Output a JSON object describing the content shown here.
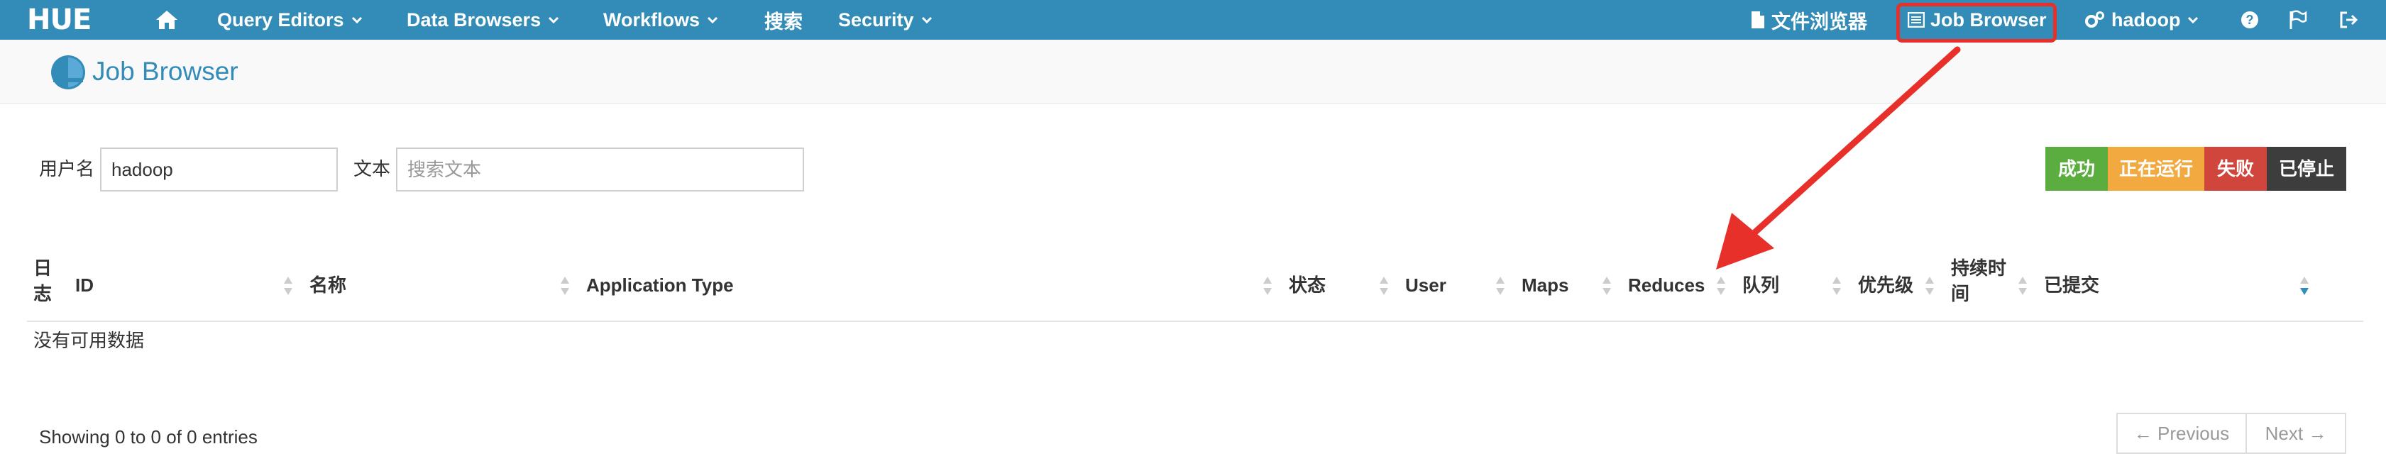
{
  "app": {
    "logo": "HUE"
  },
  "nav": {
    "query_editors": "Query Editors",
    "data_browsers": "Data Browsers",
    "workflows": "Workflows",
    "search": "搜索",
    "security": "Security",
    "file_browser": "文件浏览器",
    "job_browser": "Job Browser",
    "user": "hadoop"
  },
  "page": {
    "title": "Job Browser"
  },
  "filters": {
    "username_label": "用户名",
    "username_value": "hadoop",
    "text_label": "文本",
    "text_placeholder": "搜索文本"
  },
  "status_buttons": [
    {
      "label": "成功",
      "color": "#5cad3f"
    },
    {
      "label": "正在运行",
      "color": "#f1a940"
    },
    {
      "label": "失败",
      "color": "#d0453c"
    },
    {
      "label": "已停止",
      "color": "#3d3d3d"
    }
  ],
  "table": {
    "headers": {
      "log_line1": "日",
      "log_line2": "志",
      "id": "ID",
      "name": "名称",
      "application_type": "Application Type",
      "status": "状态",
      "user": "User",
      "maps": "Maps",
      "reduces": "Reduces",
      "queue": "队列",
      "priority": "优先级",
      "duration_line1": "持续时",
      "duration_line2": "间",
      "submitted": "已提交"
    },
    "empty_message": "没有可用数据"
  },
  "footer": {
    "showing": "Showing 0 to 0 of 0 entries",
    "previous": "← Previous",
    "next": "Next →"
  },
  "colors": {
    "navbar": "#338bb8",
    "annotation": "#e8302a"
  }
}
